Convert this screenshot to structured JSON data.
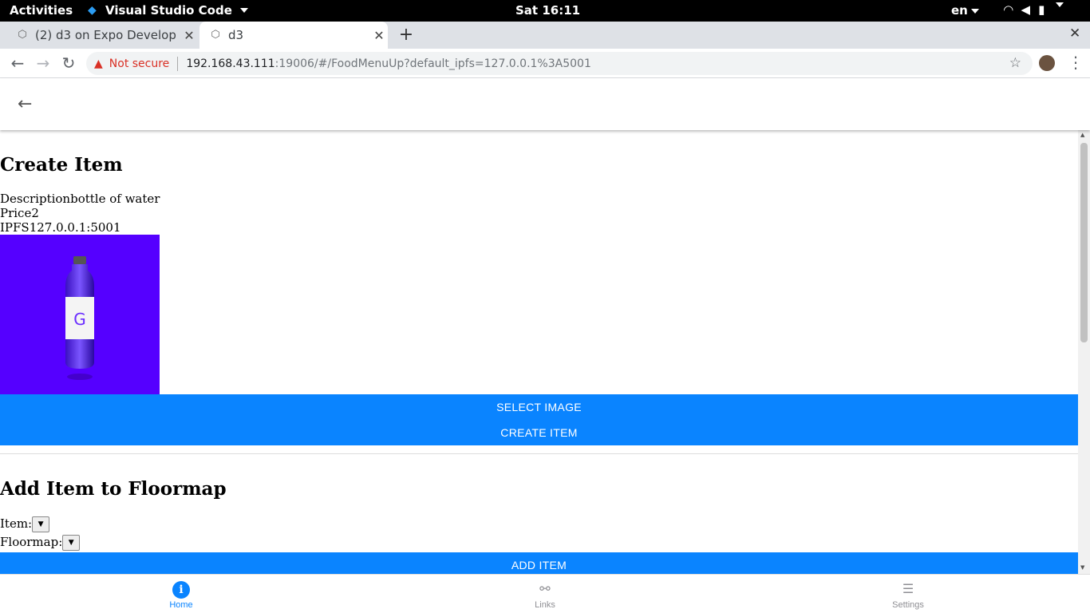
{
  "system_bar": {
    "activities": "Activities",
    "app_name": "Visual Studio Code",
    "clock": "Sat 16:11",
    "language": "en"
  },
  "browser": {
    "tabs": [
      {
        "title": "(2) d3 on Expo Develop",
        "active": false
      },
      {
        "title": "d3",
        "active": true
      }
    ],
    "security_label": "Not secure",
    "url_host": "192.168.43.111",
    "url_path": ":19006/#/FoodMenuUp?default_ipfs=127.0.0.1%3A5001"
  },
  "create_item": {
    "heading": "Create Item",
    "description_label": "Description",
    "description_value": "bottle of water",
    "price_label": "Price",
    "price_value": "2",
    "ipfs_label": "IPFS",
    "ipfs_value": "127.0.0.1:5001",
    "select_image_label": "SELECT IMAGE",
    "create_item_label": "CREATE ITEM"
  },
  "floormap": {
    "heading": "Add Item to Floormap",
    "item_label": "Item:",
    "floormap_label": "Floormap:",
    "add_item_label": "ADD ITEM"
  },
  "bottom_nav": [
    {
      "label": "Home",
      "icon": "info-icon",
      "active": true
    },
    {
      "label": "Links",
      "icon": "link-icon",
      "active": false
    },
    {
      "label": "Settings",
      "icon": "sliders-icon",
      "active": false
    }
  ],
  "colors": {
    "accent": "#0a84ff",
    "image_background": "#5500ff",
    "insecure_red": "#d93025"
  }
}
